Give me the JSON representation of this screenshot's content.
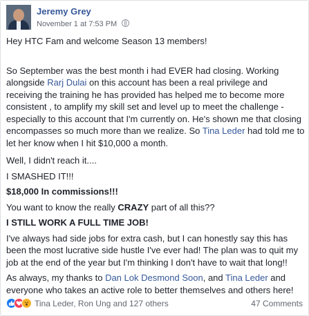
{
  "post": {
    "author": "Jeremy Grey",
    "timestamp": "November 1 at 7:53 PM",
    "greeting": "Hey HTC Fam and welcome Season 13 members!",
    "p1_part1": "So September was the best month i had EVER had closing.  Working alongside ",
    "p1_link1": "Rarj Dulai",
    "p1_part2": " on this account has been a real privilege and receiving the training he has provided has helped me to become more consistent , to amplify my skill set and level up to meet the challenge - especially to this account that I'm currently on. He's shown me that closing encompasses so much more than we realize. So ",
    "p1_link2": "Tina Leder",
    "p1_part3": " had told me to let her know when I hit $10,000 a month.",
    "line_reach": "Well, I didn't reach it....",
    "line_smashed": "I SMASHED IT!!!",
    "line_commissions": "$18,000 In commissions!!!",
    "crazy_part1": "You want to know the really ",
    "crazy_bold": "CRAZY",
    "crazy_part2": " part of all this??",
    "line_fulltime": "I STILL WORK A FULL TIME JOB!",
    "p_sidejobs": "I've always had side jobs for extra cash,  but I can honestly say this has been the most lucrative side hustle I've ever had! The plan was to quit my job at the end of the year but I'm thinking I don't have to wait that long!!",
    "thanks_part1": "As always, my thanks to ",
    "thanks_link1": "Dan Lok Desmond Soon",
    "thanks_part2": ", and ",
    "thanks_link2": "Tina Leder",
    "thanks_part3": " and everyone who takes an active role to better themselves and others here!"
  },
  "footer": {
    "reactions_text": "Tina Leder, Ron Ung and 127 others",
    "comments": "47 Comments",
    "reaction_icons": [
      "like-icon",
      "love-icon",
      "wow-icon"
    ]
  },
  "colors": {
    "link": "#365899",
    "like": "#1877f2",
    "love": "#f33e58",
    "wow": "#f7b125"
  }
}
